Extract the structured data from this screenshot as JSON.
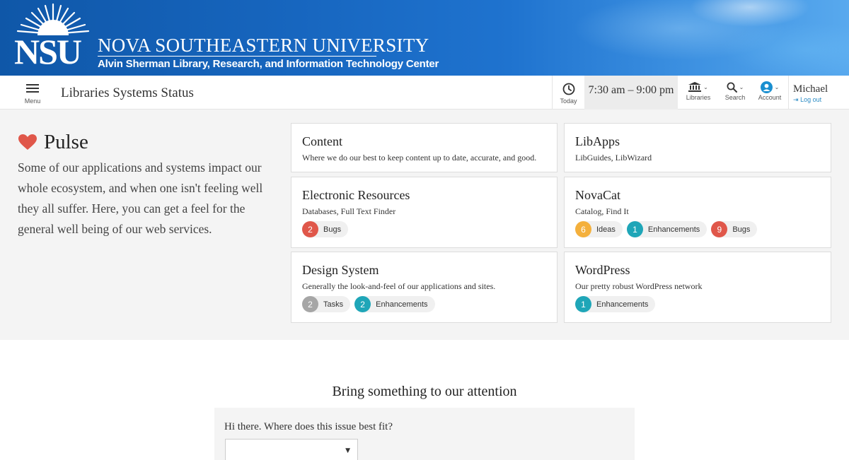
{
  "banner": {
    "logo_text": "NSU",
    "university_name": "NOVA SOUTHEASTERN UNIVERSITY",
    "subtitle": "Alvin Sherman Library, Research, and Information Technology Center"
  },
  "nav": {
    "menu_label": "Menu",
    "site_title": "Libraries Systems Status",
    "today_label": "Today",
    "hours": "7:30 am – 9:00 pm",
    "libraries_label": "Libraries",
    "search_label": "Search",
    "account_label": "Account",
    "user_name": "Michael",
    "logout_label": "Log out"
  },
  "pulse": {
    "title": "Pulse",
    "description": "Some of our applications and systems impact our whole ecosystem, and when one isn't feeling well they all suffer. Here, you can get a feel for the general well being of our web services."
  },
  "cards": [
    {
      "title": "Content",
      "description": "Where we do our best to keep content up to date, accurate, and good.",
      "chips": []
    },
    {
      "title": "LibApps",
      "description": "LibGuides, LibWizard",
      "chips": []
    },
    {
      "title": "Electronic Resources",
      "description": "Databases, Full Text Finder",
      "chips": [
        {
          "count": "2",
          "label": "Bugs",
          "color": "#e0574a"
        }
      ]
    },
    {
      "title": "NovaCat",
      "description": "Catalog, Find It",
      "chips": [
        {
          "count": "6",
          "label": "Ideas",
          "color": "#f4b03c"
        },
        {
          "count": "1",
          "label": "Enhancements",
          "color": "#1fa6b8"
        },
        {
          "count": "9",
          "label": "Bugs",
          "color": "#e0574a"
        }
      ]
    },
    {
      "title": "Design System",
      "description": "Generally the look-and-feel of our applications and sites.",
      "chips": [
        {
          "count": "2",
          "label": "Tasks",
          "color": "#a6a6a6"
        },
        {
          "count": "2",
          "label": "Enhancements",
          "color": "#1fa6b8"
        }
      ]
    },
    {
      "title": "WordPress",
      "description": "Our pretty robust WordPress network",
      "chips": [
        {
          "count": "1",
          "label": "Enhancements",
          "color": "#1fa6b8"
        }
      ]
    }
  ],
  "attention": {
    "title": "Bring something to our attention",
    "question": "Hi there. Where does this issue best fit?",
    "select_value": ""
  },
  "colors": {
    "heart": "#e0574a",
    "link": "#2a8bc4"
  },
  "icons": [
    "sunburst-logo-icon",
    "menu-icon",
    "clock-icon",
    "library-icon",
    "search-icon",
    "account-icon",
    "logout-icon",
    "heart-icon",
    "chevron-down-icon"
  ]
}
